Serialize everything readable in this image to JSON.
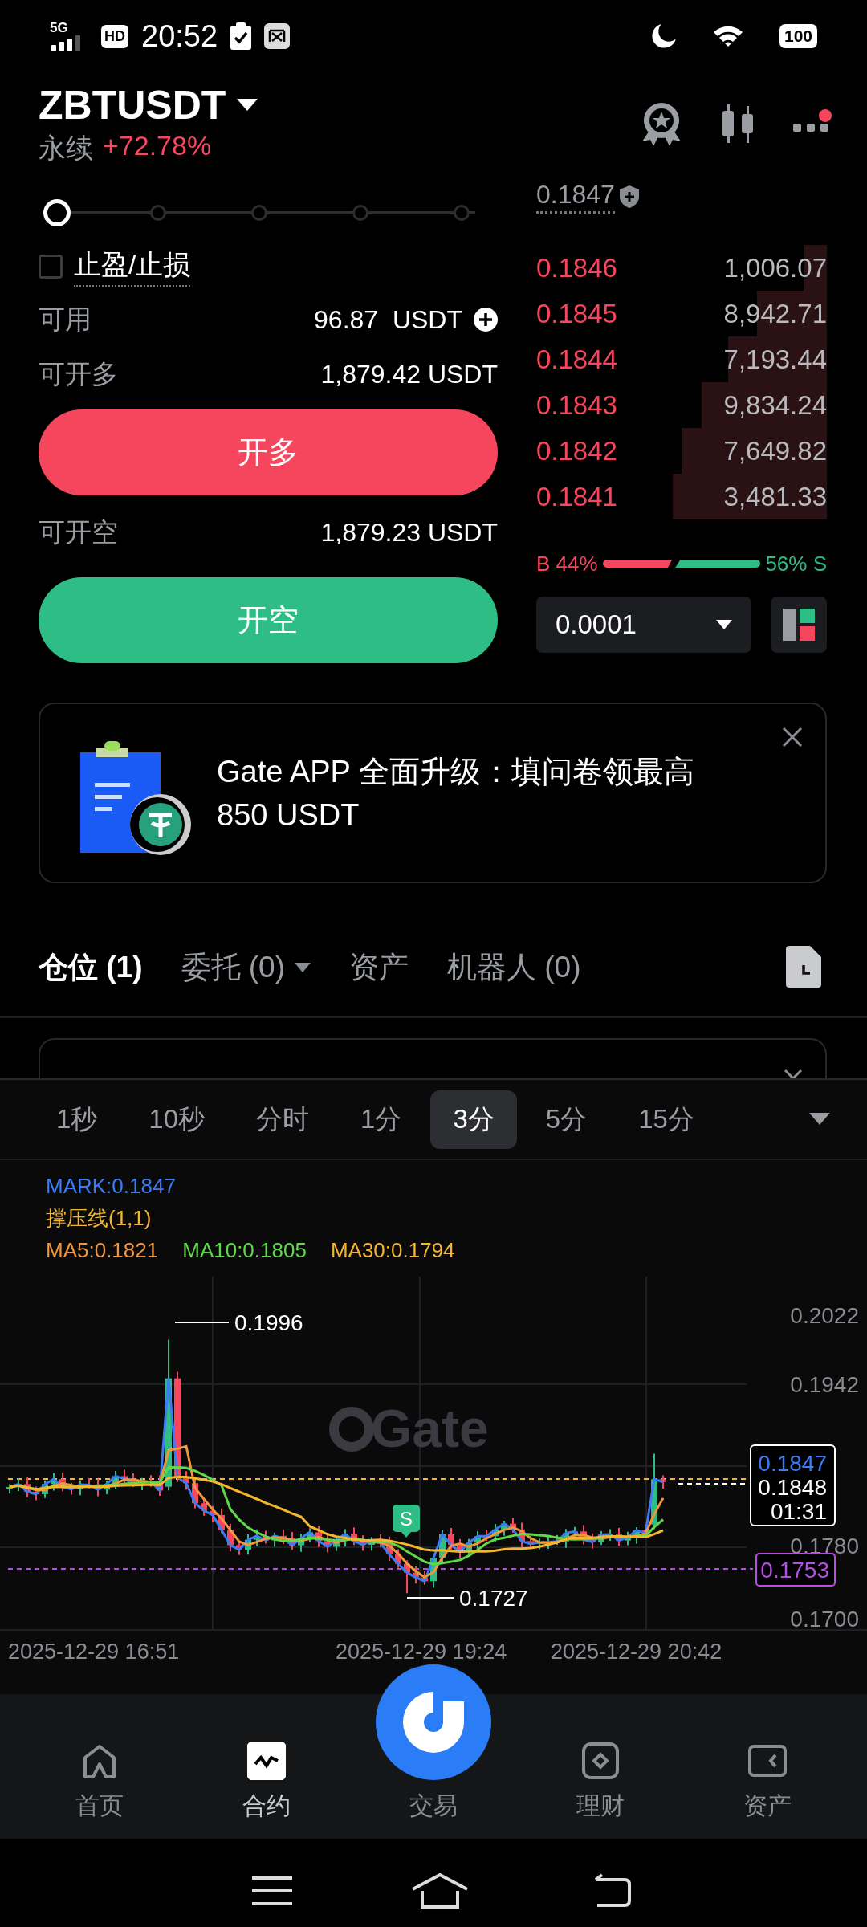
{
  "status_bar": {
    "network": "5G",
    "hd": "HD",
    "time": "20:52",
    "battery": "100"
  },
  "header": {
    "symbol": "ZBTUSDT",
    "type": "永续",
    "change": "+72.78%",
    "has_notification": true
  },
  "order_form": {
    "slider": {
      "level": 0
    },
    "tp_sl": {
      "label": "止盈/止损",
      "checked": false
    },
    "available": {
      "label": "可用",
      "value": "96.87  USDT"
    },
    "long": {
      "label": "可开多",
      "value": "1,879.42 USDT",
      "button": "开多"
    },
    "short": {
      "label": "可开空",
      "value": "1,879.23 USDT",
      "button": "开空"
    }
  },
  "order_book": {
    "mark_price": "0.1847",
    "asks": [
      {
        "price": "0.1846",
        "amount": "1,006.07"
      },
      {
        "price": "0.1845",
        "amount": "8,942.71"
      },
      {
        "price": "0.1844",
        "amount": "7,193.44"
      },
      {
        "price": "0.1843",
        "amount": "9,834.24"
      },
      {
        "price": "0.1842",
        "amount": "7,649.82"
      },
      {
        "price": "0.1841",
        "amount": "3,481.33"
      }
    ],
    "ratio": {
      "buy": "B 44%",
      "sell": "56% S"
    },
    "precision": "0.0001"
  },
  "banner": {
    "text": "Gate APP 全面升级：填问卷领最高 850 USDT"
  },
  "position_tabs": [
    {
      "label": "仓位 (1)",
      "selected": true,
      "kind": "tab"
    },
    {
      "label": "委托 (0)",
      "selected": false,
      "kind": "dropdown"
    },
    {
      "label": "资产",
      "selected": false,
      "kind": "tab"
    },
    {
      "label": "机器人 (0)",
      "selected": false,
      "kind": "tab"
    }
  ],
  "intervals": [
    {
      "label": "1秒",
      "selected": false
    },
    {
      "label": "10秒",
      "selected": false
    },
    {
      "label": "分时",
      "selected": false
    },
    {
      "label": "1分",
      "selected": false
    },
    {
      "label": "3分",
      "selected": true
    },
    {
      "label": "5分",
      "selected": false
    },
    {
      "label": "15分",
      "selected": false
    }
  ],
  "chart": {
    "mark": "MARK:0.1847",
    "sr_line": "撑压线(1,1)",
    "ma": [
      {
        "label": "MA5:0.1821",
        "color": "#f0963c"
      },
      {
        "label": "MA10:0.1805",
        "color": "#5fd84a"
      },
      {
        "label": "MA30:0.1794",
        "color": "#f5b52e"
      }
    ],
    "watermark": "Gate",
    "y_labels": [
      "0.2022",
      "0.1942",
      "0.1780",
      "0.1700"
    ],
    "high": "0.1996",
    "low": "0.1727",
    "signal": "S",
    "last_price": "0.1847",
    "price": "0.1848",
    "countdown": "01:31",
    "liq_price": "0.1753",
    "x_labels": [
      "2025-12-29 16:51",
      "2025-12-29 19:24",
      "2025-12-29 20:42"
    ]
  },
  "nav": [
    {
      "label": "首页",
      "kind": "tab",
      "selected": false
    },
    {
      "label": "合约",
      "kind": "tab",
      "selected": true
    },
    {
      "label": "交易",
      "kind": "center",
      "selected": false
    },
    {
      "label": "理财",
      "kind": "tab",
      "selected": false
    },
    {
      "label": "资产",
      "kind": "tab",
      "selected": false
    }
  ]
}
